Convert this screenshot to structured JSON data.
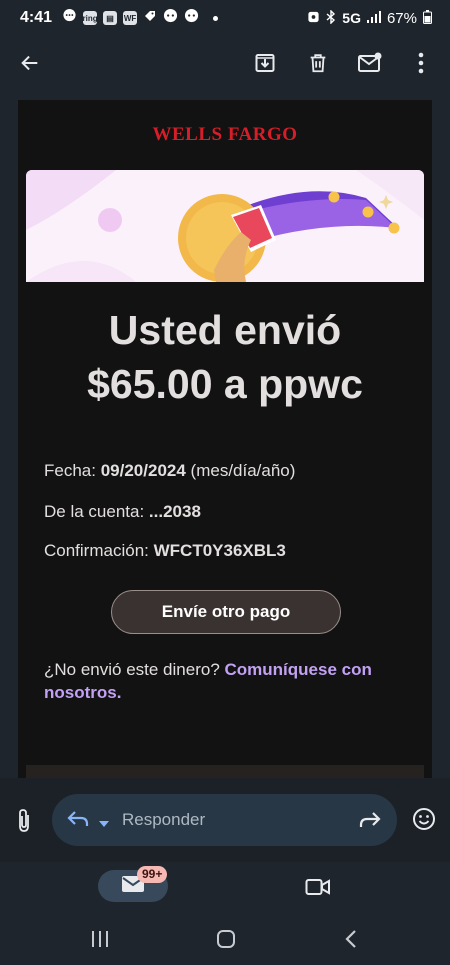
{
  "status_bar": {
    "time": "4:41",
    "notification_icons": [
      "chat-bubble-icon",
      "ring-icon",
      "app-icon",
      "wf-icon",
      "tag-icon",
      "reddit-icon",
      "reddit-icon"
    ],
    "ring_label": "ring",
    "wf_label": "WF",
    "network": "5G",
    "battery": "67%"
  },
  "toolbar": {
    "icons": [
      "back-arrow-icon",
      "archive-icon",
      "trash-icon",
      "mark-unread-icon",
      "more-vert-icon"
    ]
  },
  "email": {
    "brand": "WELLS FARGO",
    "headline_line1": "Usted envió",
    "headline_line2": "$65.00 a ppwc",
    "date_label": "Fecha:",
    "date_value": "09/20/2024",
    "date_format": "(mes/día/año)",
    "account_label": "De la cuenta:",
    "account_value": "...2038",
    "confirmation_label": "Confirmación:",
    "confirmation_value": "WFCT0Y36XBL3",
    "send_again_button": "Envíe otro pago",
    "not_sent_text": "¿No envió este dinero?",
    "contact_link": "Comuníquese con nosotros",
    "contact_period": "."
  },
  "reply_bar": {
    "placeholder": "Responder"
  },
  "bottom_nav": {
    "mail_badge": "99+"
  },
  "colors": {
    "brand_red": "#d71e28",
    "link_purple": "#c2a1f2",
    "background": "#1e252d"
  }
}
